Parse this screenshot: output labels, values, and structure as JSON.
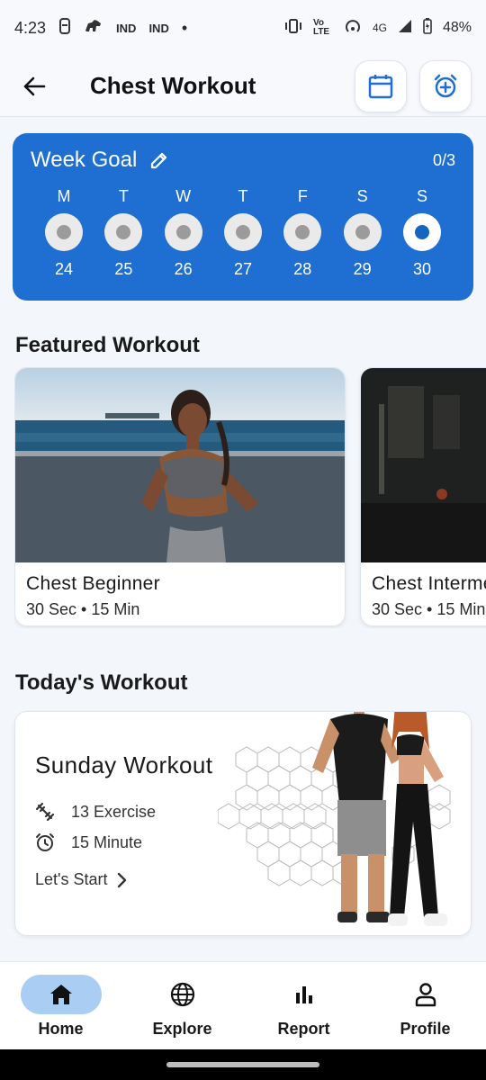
{
  "status_bar": {
    "time": "4:23",
    "carrier_1": "IND",
    "carrier_2": "IND",
    "network": "4G",
    "volte": "Vo LTE",
    "battery": "48%"
  },
  "app_bar": {
    "title": "Chest Workout"
  },
  "week_goal": {
    "title": "Week Goal",
    "count": "0/3",
    "days": [
      {
        "letter": "M",
        "date": "24"
      },
      {
        "letter": "T",
        "date": "25"
      },
      {
        "letter": "W",
        "date": "26"
      },
      {
        "letter": "T",
        "date": "27"
      },
      {
        "letter": "F",
        "date": "28"
      },
      {
        "letter": "S",
        "date": "29"
      },
      {
        "letter": "S",
        "date": "30"
      }
    ]
  },
  "featured": {
    "heading": "Featured Workout",
    "cards": [
      {
        "name": "Chest Beginner",
        "meta": "30 Sec • 15 Min"
      },
      {
        "name": "Chest Intermediate",
        "meta": "30 Sec • 15 Min"
      }
    ]
  },
  "today": {
    "heading": "Today's Workout",
    "title": "Sunday Workout",
    "exercises": "13 Exercise",
    "duration": "15 Minute",
    "start_label": "Let's Start"
  },
  "nav": {
    "items": [
      {
        "label": "Home"
      },
      {
        "label": "Explore"
      },
      {
        "label": "Report"
      },
      {
        "label": "Profile"
      }
    ]
  },
  "colors": {
    "accent": "#1e6fd1",
    "nav_active": "#a9cdf3"
  }
}
